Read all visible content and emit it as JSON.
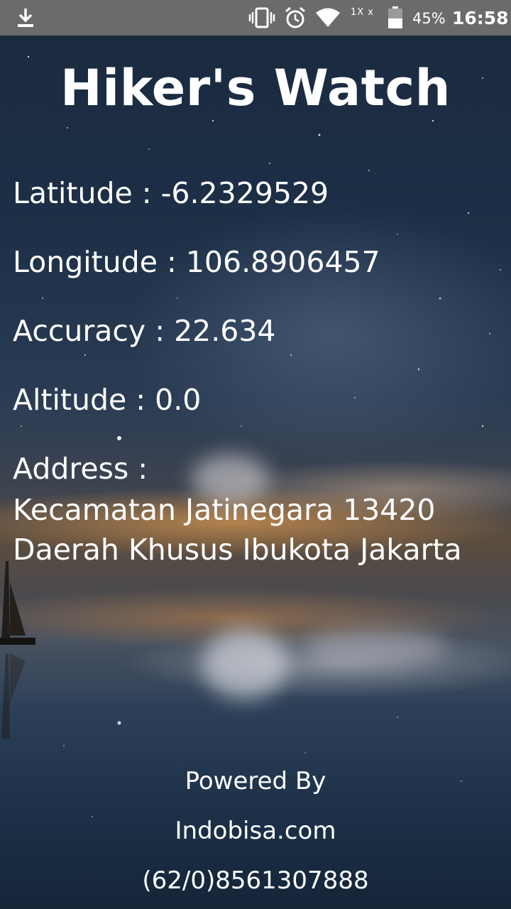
{
  "status_bar": {
    "icons": [
      "download-icon",
      "vibrate-icon",
      "alarm-icon",
      "wifi-icon",
      "data-speed-indicator",
      "battery-icon"
    ],
    "data_speed": "1X x",
    "battery_percent": "45%",
    "time": "16:58"
  },
  "app": {
    "title": "Hiker's Watch"
  },
  "location": {
    "latitude_label": "Latitude : ",
    "latitude_value": "-6.2329529",
    "longitude_label": "Longitude : ",
    "longitude_value": "106.8906457",
    "accuracy_label": "Accuracy : ",
    "accuracy_value": "22.634",
    "altitude_label": "Altitude : ",
    "altitude_value": "0.0",
    "address_label": "Address :",
    "address_line1": "Kecamatan Jatinegara 13420",
    "address_line2": "Daerah Khusus Ibukota Jakarta"
  },
  "footer": {
    "powered_by": "Powered By",
    "company": "Indobisa.com",
    "phone": "(62/0)8561307888"
  },
  "colors": {
    "status_bar_bg": "#6b6b6b",
    "text": "#ffffff"
  }
}
